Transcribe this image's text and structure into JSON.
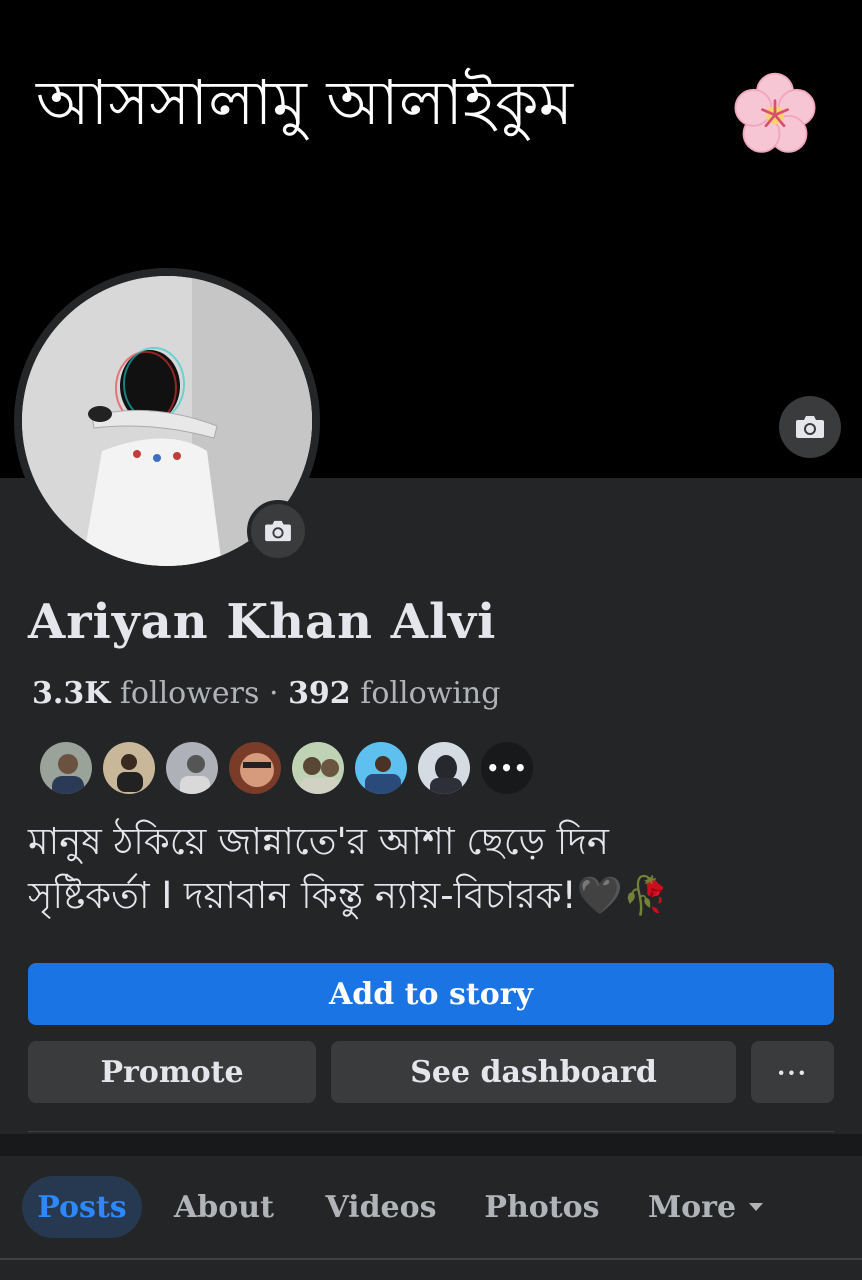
{
  "cover": {
    "greeting": "আসসালামু আলাইকুম",
    "emoji": "cherry-blossom"
  },
  "profile": {
    "name": "Ariyan Khan Alvi",
    "followers_count": "3.3K",
    "followers_label": "followers",
    "separator": "·",
    "following_count": "392",
    "following_label": "following",
    "friends_more_label": "•••",
    "bio_line1": "মানুষ ঠকিয়ে জান্নাতে'র আশা ছেড়ে দিন",
    "bio_line2": "সৃষ্টিকর্তা I দয়াবান কিন্তু ন্যায়-বিচারক!🖤🥀"
  },
  "actions": {
    "add_to_story": "Add to story",
    "promote": "Promote",
    "see_dashboard": "See dashboard",
    "more_options": "···"
  },
  "tabs": {
    "posts": "Posts",
    "about": "About",
    "videos": "Videos",
    "photos": "Photos",
    "more": "More",
    "active": "posts"
  },
  "colors": {
    "accent": "#1b74e4",
    "active_tab_text": "#2d88ff",
    "active_tab_bg": "#263951",
    "surface": "#242526",
    "button": "#3a3b3c"
  }
}
